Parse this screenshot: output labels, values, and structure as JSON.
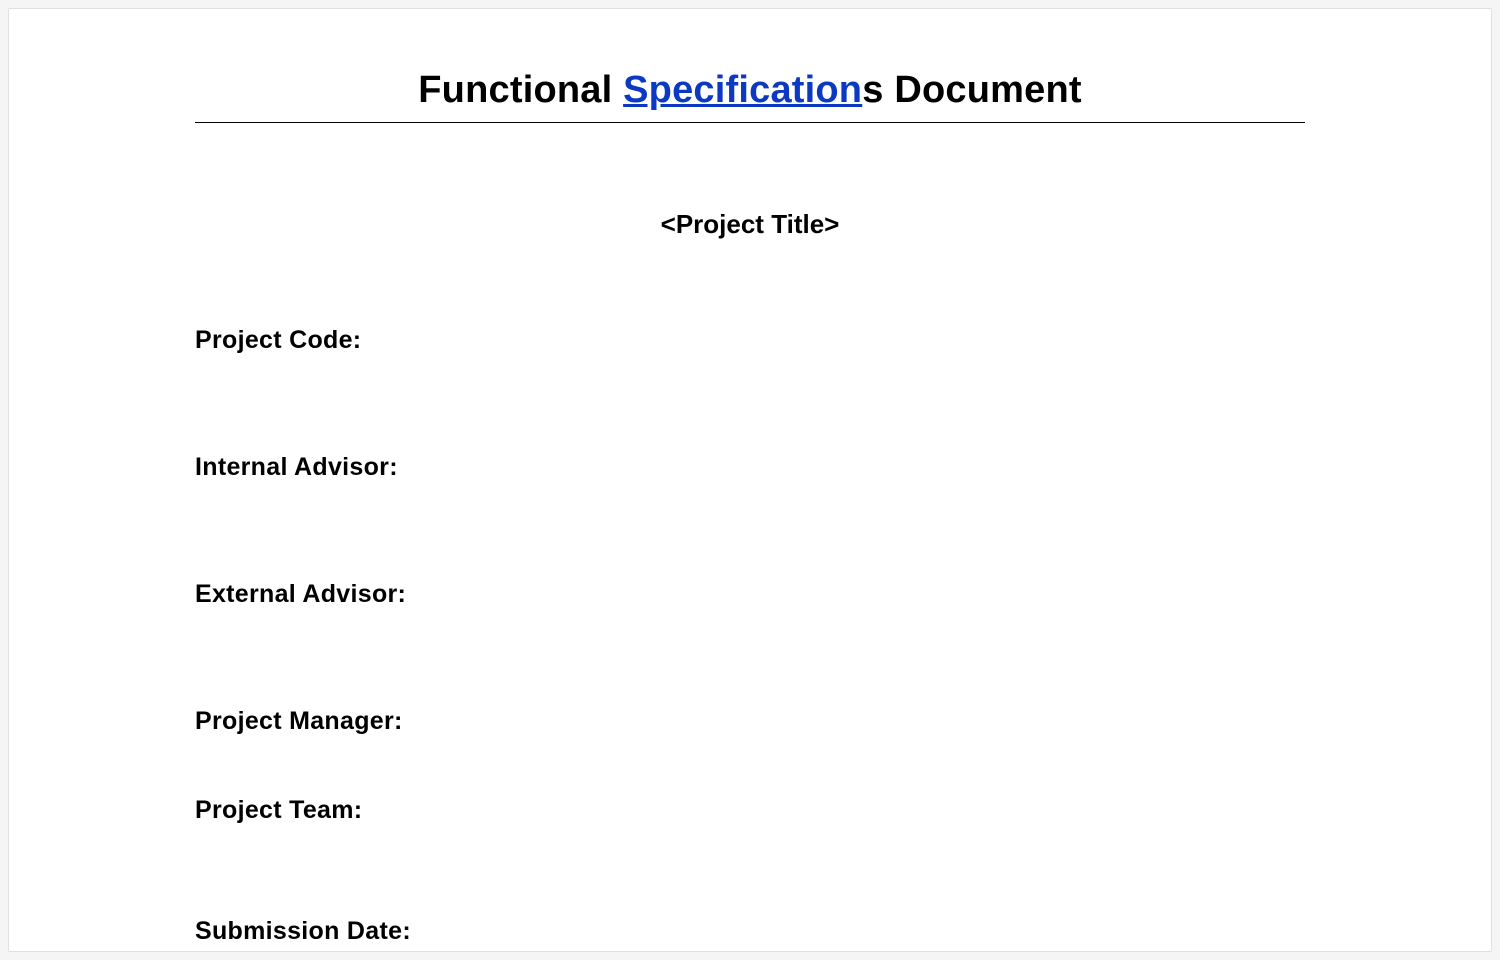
{
  "title": {
    "part1": "Functional ",
    "link": "Specification",
    "part2": "s Document"
  },
  "subtitle": "<Project Title>",
  "fields": {
    "project_code": "Project Code:",
    "internal_advisor": "Internal Advisor:",
    "external_advisor": "External Advisor:",
    "project_manager": "Project Manager:",
    "project_team": "Project Team:",
    "submission_date": "Submission Date:"
  }
}
